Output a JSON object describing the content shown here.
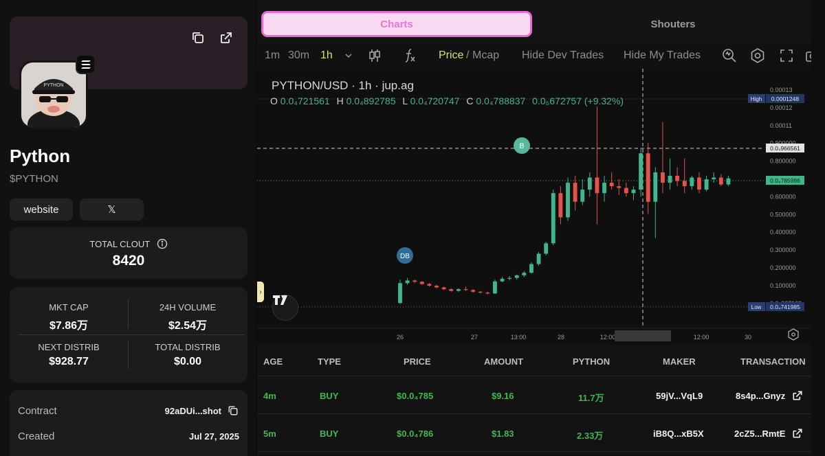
{
  "token": {
    "name": "Python",
    "ticker": "$PYTHON",
    "links": {
      "website": "website",
      "x": "𝕏"
    }
  },
  "clout": {
    "label": "TOTAL CLOUT",
    "value": "8420"
  },
  "stats": {
    "mkt_cap_label": "MKT CAP",
    "mkt_cap": "$7.86万",
    "volume_label": "24H VOLUME",
    "volume": "$2.54万",
    "next_distrib_label": "NEXT DISTRIB",
    "next_distrib": "$928.77",
    "total_distrib_label": "TOTAL DISTRIB",
    "total_distrib": "$0.00"
  },
  "info": {
    "contract_label": "Contract",
    "contract_value": "92aDUi...shot",
    "created_label": "Created",
    "created_value": "Jul 27, 2025"
  },
  "tabs": {
    "charts": "Charts",
    "shouters": "Shouters"
  },
  "toolbar": {
    "tf_1m": "1m",
    "tf_30m": "30m",
    "tf_1h": "1h",
    "price": "Price",
    "sep": "/",
    "mcap": "Mcap",
    "hide_dev": "Hide Dev Trades",
    "hide_my": "Hide My Trades"
  },
  "chart_header": {
    "pair": "PYTHON/USD · 1h · jup.ag",
    "o_label": "O",
    "o": "0.0₄721561",
    "h_label": "H",
    "h": "0.0₄892785",
    "l_label": "L",
    "l": "0.0₄720747",
    "c_label": "C",
    "c": "0.0₄788837",
    "change": "0.0₅672757 (+9.32%)"
  },
  "chart_data": {
    "type": "candlestick",
    "series": [
      {
        "name": "PYTHON/USD",
        "candles": [
          {
            "o": 6.5e-05,
            "h": 0.0002,
            "l": 6e-05,
            "c": 0.00018
          },
          {
            "o": 0.00018,
            "h": 0.00021,
            "l": 0.00017,
            "c": 0.000195
          },
          {
            "o": 0.000195,
            "h": 0.0002,
            "l": 0.00018,
            "c": 0.000188
          },
          {
            "o": 0.000188,
            "h": 0.00019,
            "l": 0.00017,
            "c": 0.000175
          },
          {
            "o": 0.000175,
            "h": 0.00018,
            "l": 0.00016,
            "c": 0.000165
          },
          {
            "o": 0.000165,
            "h": 0.00017,
            "l": 0.00015,
            "c": 0.000155
          },
          {
            "o": 0.000155,
            "h": 0.00016,
            "l": 0.00014,
            "c": 0.000145
          },
          {
            "o": 0.000145,
            "h": 0.00015,
            "l": 0.00013,
            "c": 0.000135
          },
          {
            "o": 0.000135,
            "h": 0.00015,
            "l": 0.00013,
            "c": 0.000145
          },
          {
            "o": 0.000145,
            "h": 0.00016,
            "l": 0.000135,
            "c": 0.00014
          },
          {
            "o": 0.00014,
            "h": 0.000145,
            "l": 0.000125,
            "c": 0.00013
          },
          {
            "o": 0.00013,
            "h": 0.000135,
            "l": 0.00012,
            "c": 0.000125
          },
          {
            "o": 0.000125,
            "h": 0.00013,
            "l": 0.000115,
            "c": 0.00012
          },
          {
            "o": 0.00012,
            "h": 0.0002,
            "l": 0.000118,
            "c": 0.00019
          },
          {
            "o": 0.00019,
            "h": 0.000215,
            "l": 0.000185,
            "c": 0.000205
          },
          {
            "o": 0.000205,
            "h": 0.00022,
            "l": 0.000195,
            "c": 0.00021
          },
          {
            "o": 0.00021,
            "h": 0.00023,
            "l": 0.0002,
            "c": 0.000225
          },
          {
            "o": 0.000225,
            "h": 0.00025,
            "l": 0.000215,
            "c": 0.00024
          },
          {
            "o": 0.00024,
            "h": 0.0003,
            "l": 0.000235,
            "c": 0.00029
          },
          {
            "o": 0.00029,
            "h": 0.00036,
            "l": 0.00028,
            "c": 0.00035
          },
          {
            "o": 0.00035,
            "h": 0.00042,
            "l": 0.00034,
            "c": 0.00041
          },
          {
            "o": 0.00041,
            "h": 0.00072,
            "l": 0.0004,
            "c": 0.0007
          },
          {
            "o": 0.0007,
            "h": 0.00074,
            "l": 0.00052,
            "c": 0.00056
          },
          {
            "o": 0.00056,
            "h": 0.00079,
            "l": 0.00054,
            "c": 0.00076
          },
          {
            "o": 0.00076,
            "h": 0.0008,
            "l": 0.0006,
            "c": 0.00065
          },
          {
            "o": 0.00065,
            "h": 0.00078,
            "l": 0.00063,
            "c": 0.00072
          },
          {
            "o": 0.00072,
            "h": 0.00082,
            "l": 0.00068,
            "c": 0.00079
          },
          {
            "o": 0.00079,
            "h": 0.0012,
            "l": 0.00052,
            "c": 0.0007
          },
          {
            "o": 0.0007,
            "h": 0.0008,
            "l": 0.00065,
            "c": 0.00076
          },
          {
            "o": 0.00076,
            "h": 0.00082,
            "l": 0.00072,
            "c": 0.00074
          },
          {
            "o": 0.00074,
            "h": 0.00078,
            "l": 0.00069,
            "c": 0.00073
          },
          {
            "o": 0.00073,
            "h": 0.00076,
            "l": 0.00068,
            "c": 0.0007
          },
          {
            "o": 0.0007,
            "h": 0.00074,
            "l": 0.00066,
            "c": 0.00072
          },
          {
            "o": 0.00072,
            "h": 0.00096,
            "l": 0.00068,
            "c": 0.00093
          },
          {
            "o": 0.00093,
            "h": 0.00099,
            "l": 0.00058,
            "c": 0.00065
          },
          {
            "o": 0.00065,
            "h": 0.00085,
            "l": 0.00044,
            "c": 0.00082
          },
          {
            "o": 0.00082,
            "h": 0.00111,
            "l": 0.0007,
            "c": 0.00076
          },
          {
            "o": 0.00076,
            "h": 0.0009,
            "l": 0.00072,
            "c": 0.0008
          },
          {
            "o": 0.0008,
            "h": 0.00085,
            "l": 0.00074,
            "c": 0.00077
          },
          {
            "o": 0.00077,
            "h": 0.0009,
            "l": 0.0007,
            "c": 0.00074
          },
          {
            "o": 0.00074,
            "h": 0.0008,
            "l": 0.00072,
            "c": 0.00079
          },
          {
            "o": 0.00079,
            "h": 0.00082,
            "l": 0.0007,
            "c": 0.00072
          },
          {
            "o": 0.00072,
            "h": 0.0008,
            "l": 0.00071,
            "c": 0.00078
          },
          {
            "o": 0.00078,
            "h": 0.00082,
            "l": 0.00076,
            "c": 0.00079
          },
          {
            "o": 0.00079,
            "h": 0.00081,
            "l": 0.00074,
            "c": 0.00075
          },
          {
            "o": 0.00075,
            "h": 0.0008,
            "l": 0.00074,
            "c": 0.000785
          }
        ]
      }
    ],
    "y_ticks": [
      "0.00013",
      "0.00012",
      "0.00011",
      "0.900000",
      "0.800000",
      "0.700000",
      "0.600000",
      "0.500000",
      "0.400000",
      "0.300000",
      "0.200000",
      "0.100000",
      "0.0₄237169"
    ],
    "x_ticks": [
      "26",
      "27",
      "13:00",
      "28",
      "12:00",
      "28 Jul '25",
      "21:00",
      "12:00",
      "30"
    ],
    "labels": {
      "high": "High",
      "high_val": "0.0001248",
      "low": "Low",
      "low_val": "0.0₄741985",
      "crosshair": "0.0₄966561",
      "last": "0.0₄785986"
    },
    "markers": {
      "b": "B",
      "db": "DB"
    },
    "colors": {
      "up": "#3fb68b",
      "down": "#e5534b"
    }
  },
  "trades": {
    "headers": [
      "AGE",
      "TYPE",
      "PRICE",
      "AMOUNT",
      "PYTHON",
      "MAKER",
      "TRANSACTION"
    ],
    "rows": [
      {
        "age": "4m",
        "type": "BUY",
        "price": "$0.0₄785",
        "amount": "$9.16",
        "python": "11.7万",
        "maker": "59jV...VqL9",
        "tx": "8s4p...Gnyz"
      },
      {
        "age": "5m",
        "type": "BUY",
        "price": "$0.0₄786",
        "amount": "$1.83",
        "python": "2.33万",
        "maker": "iB8Q...xB5X",
        "tx": "2cZ5...RmtE"
      }
    ]
  }
}
